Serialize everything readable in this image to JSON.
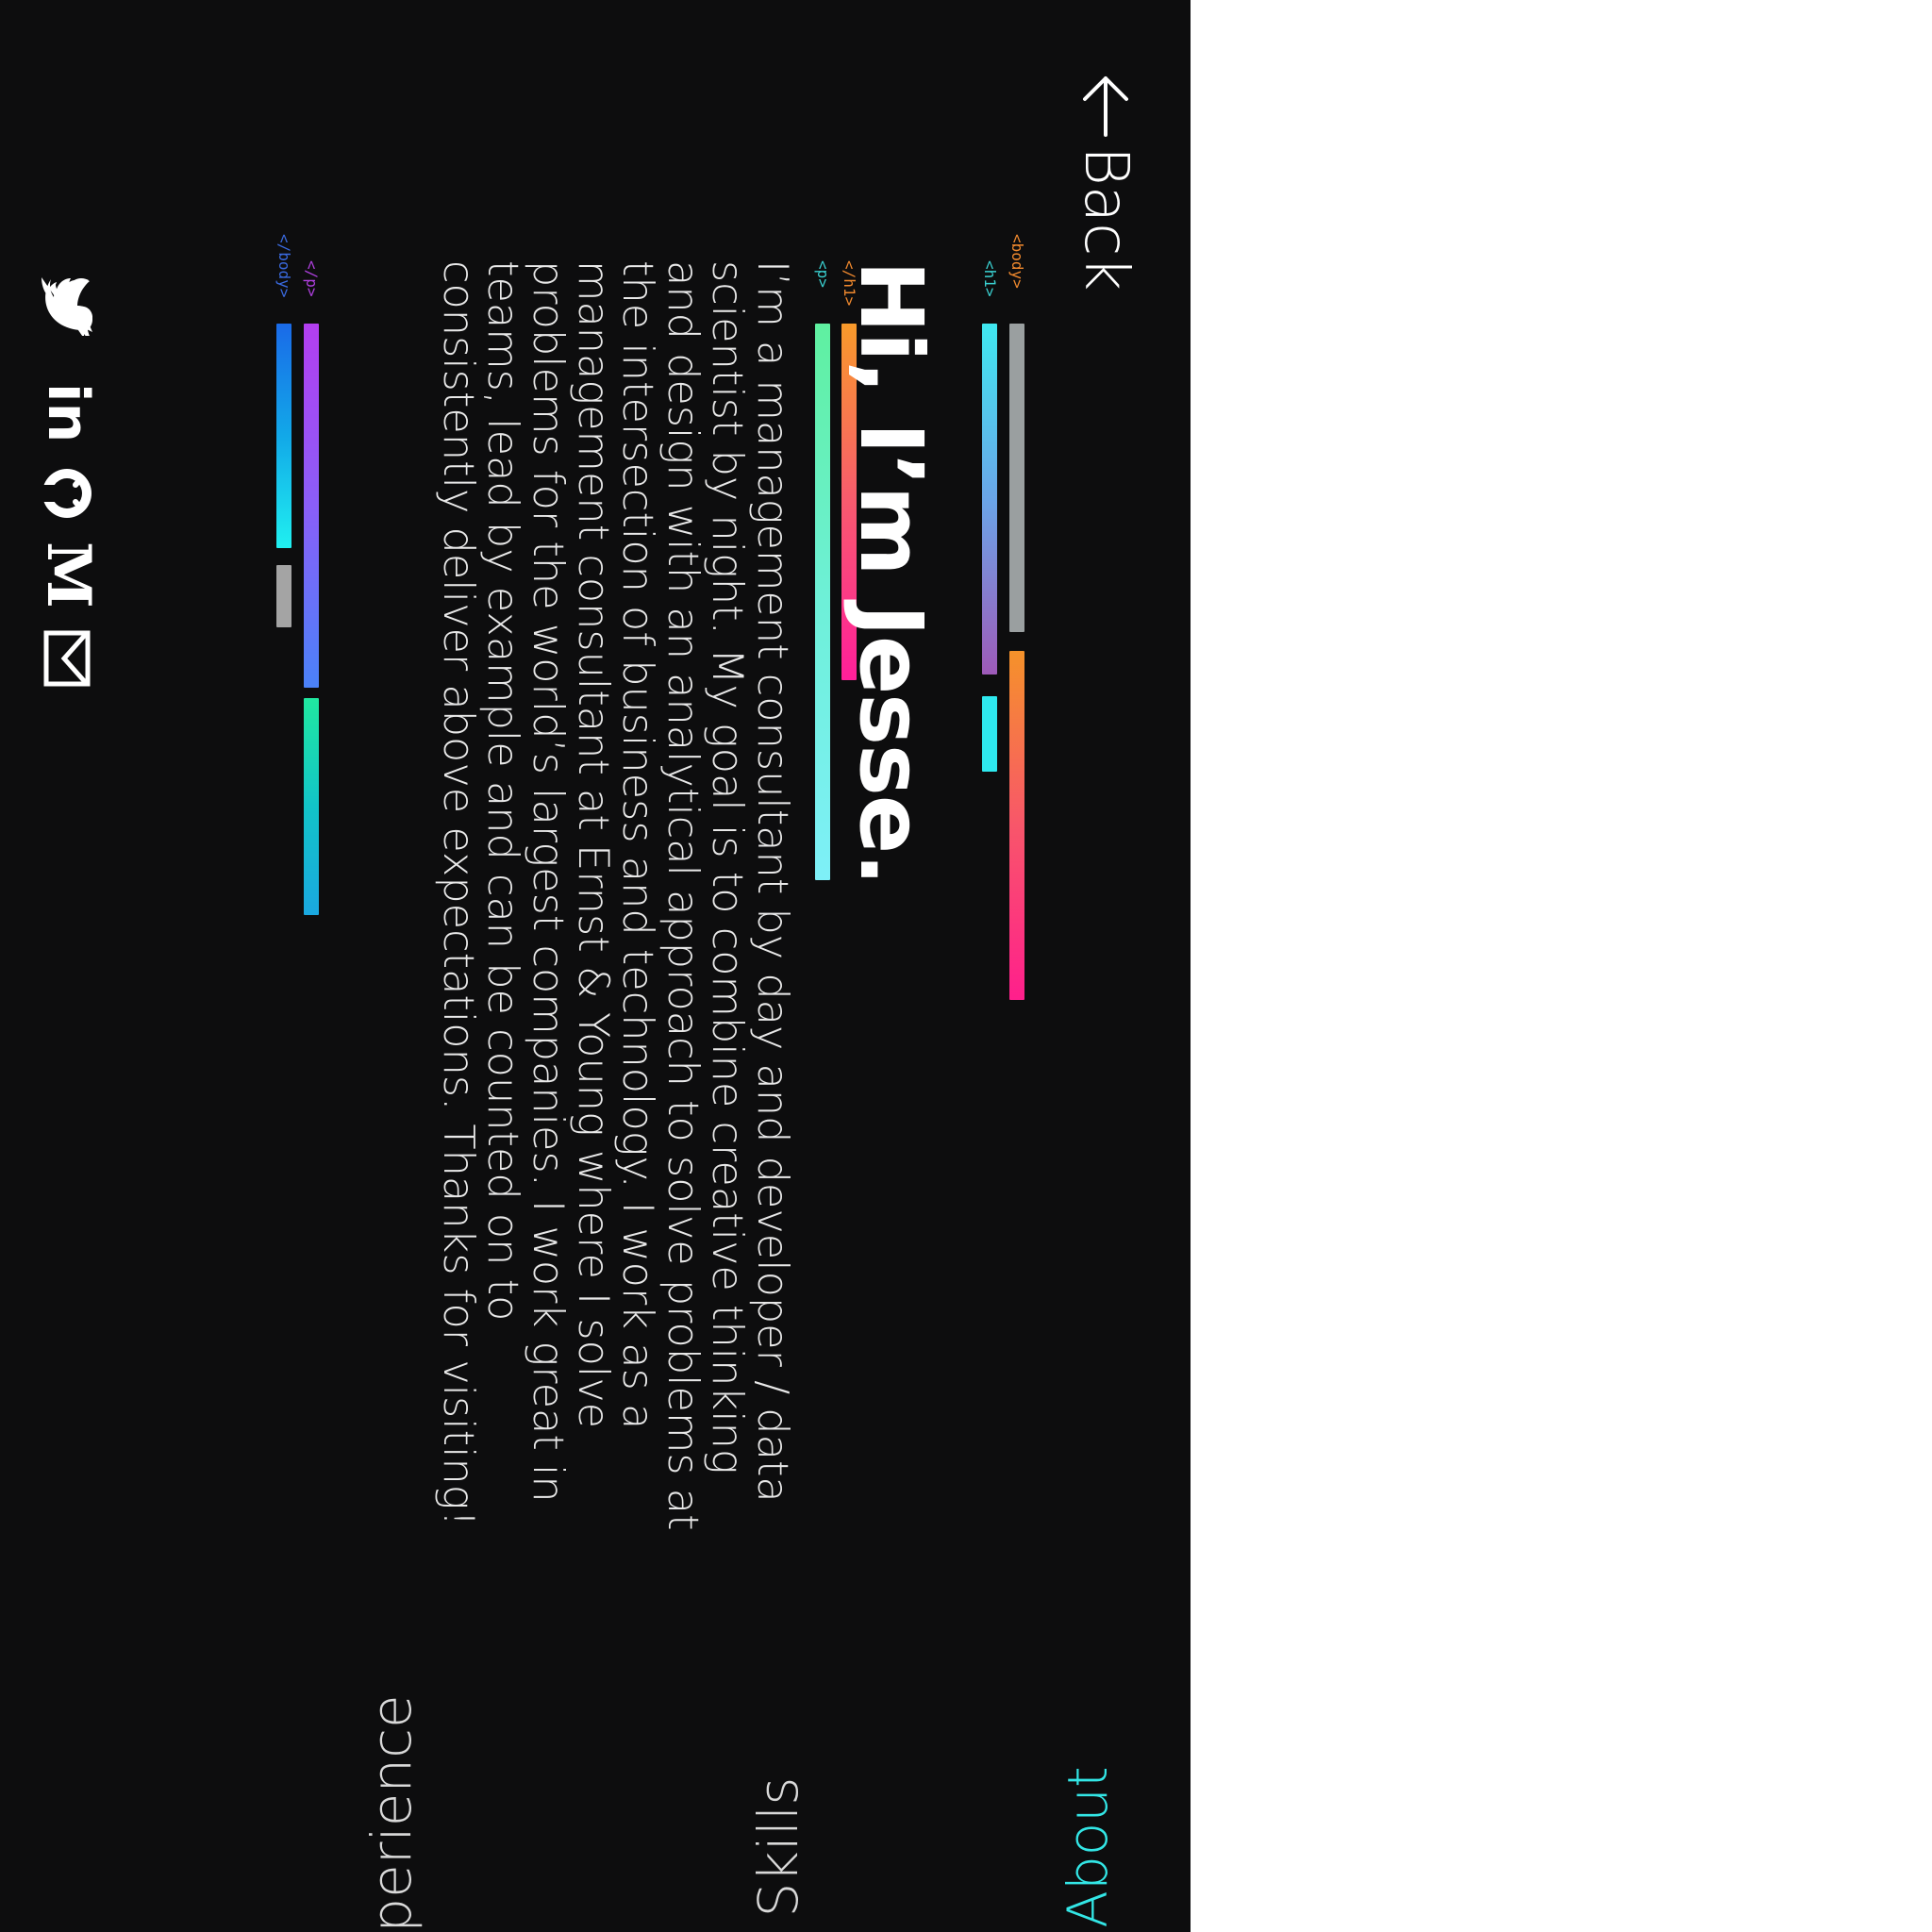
{
  "header": {
    "back_label": "Back"
  },
  "tags": {
    "body_open": "<body>",
    "h1_open": "<h1>",
    "h1_close": "</h1>",
    "p_open": "<p>",
    "p_close": "</p>",
    "body_close": "</body>"
  },
  "main": {
    "heading": "Hi, I’m Jesse.",
    "paragraph": "I’m a management consultant by day and developer / data scientist by night. My goal is to combine creative thinking and design with an analytical approach to solve problems at the intersection of business and technology. I work as a management consultant at Ernst & Young where I solve problems for the world’s largest companies. I work great in teams, lead by example and can be counted on to consistently deliver above expectations. Thanks for visiting!"
  },
  "nav": {
    "items": [
      {
        "label": "About",
        "active": true
      },
      {
        "label": "Skills",
        "active": false
      },
      {
        "label": "Experience",
        "active": false
      }
    ]
  },
  "social": {
    "icons": [
      "twitter-icon",
      "linkedin-icon",
      "github-icon",
      "medium-icon",
      "email-icon"
    ]
  },
  "colors": {
    "background": "#0d0d0e",
    "accent": "#33e6e6",
    "text": "#ffffff",
    "tag_orange": "#f28a2e",
    "tag_cyan": "#3ad1d1",
    "tag_purple": "#b040e0",
    "tag_blue": "#3a6ae0"
  }
}
